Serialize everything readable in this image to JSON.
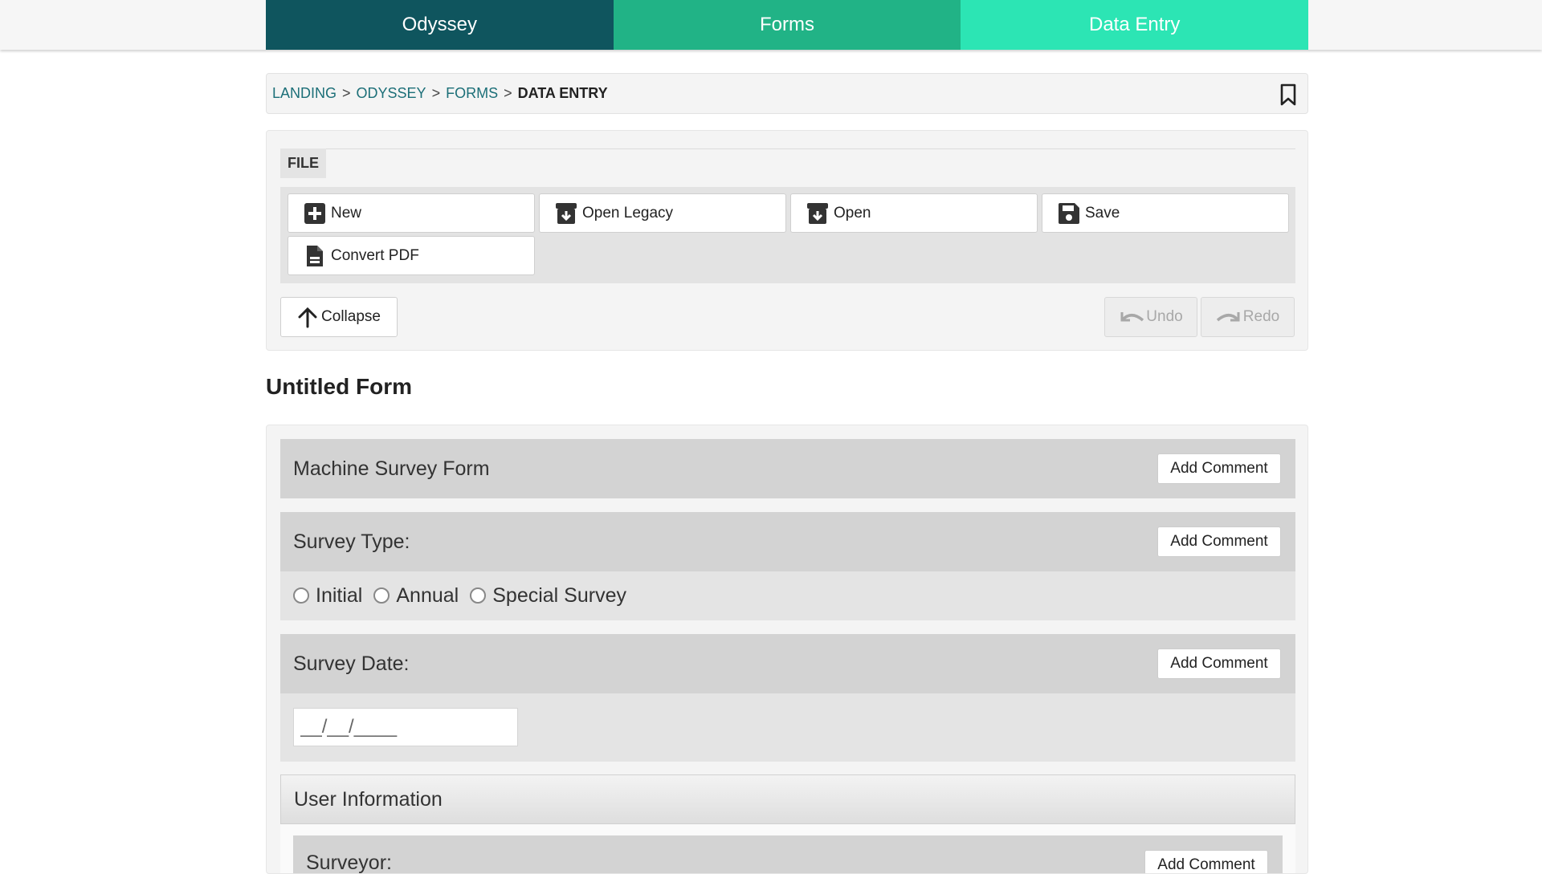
{
  "tabs": [
    {
      "label": "Odyssey"
    },
    {
      "label": "Forms"
    },
    {
      "label": "Data Entry"
    }
  ],
  "breadcrumb": {
    "items": [
      "LANDING",
      "ODYSSEY",
      "FORMS"
    ],
    "current": "DATA ENTRY",
    "separator": ">"
  },
  "file_panel": {
    "label": "FILE",
    "buttons": {
      "new": "New",
      "open_legacy": "Open Legacy",
      "open": "Open",
      "save": "Save",
      "convert_pdf": "Convert PDF"
    },
    "collapse": "Collapse",
    "undo": "Undo",
    "redo": "Redo"
  },
  "form": {
    "title": "Untitled Form",
    "add_comment": "Add Comment",
    "sections": {
      "machine_survey": "Machine Survey Form",
      "survey_type": {
        "label": "Survey Type:",
        "options": [
          "Initial",
          "Annual",
          "Special Survey"
        ]
      },
      "survey_date": {
        "label": "Survey Date:",
        "value": "__/__/____"
      },
      "user_information": "User Information",
      "surveyor": "Surveyor:"
    }
  },
  "colors": {
    "tab_dark": "#0f555e",
    "tab_mid": "#21b386",
    "tab_light": "#2ce5b4",
    "link": "#1c6f78"
  }
}
